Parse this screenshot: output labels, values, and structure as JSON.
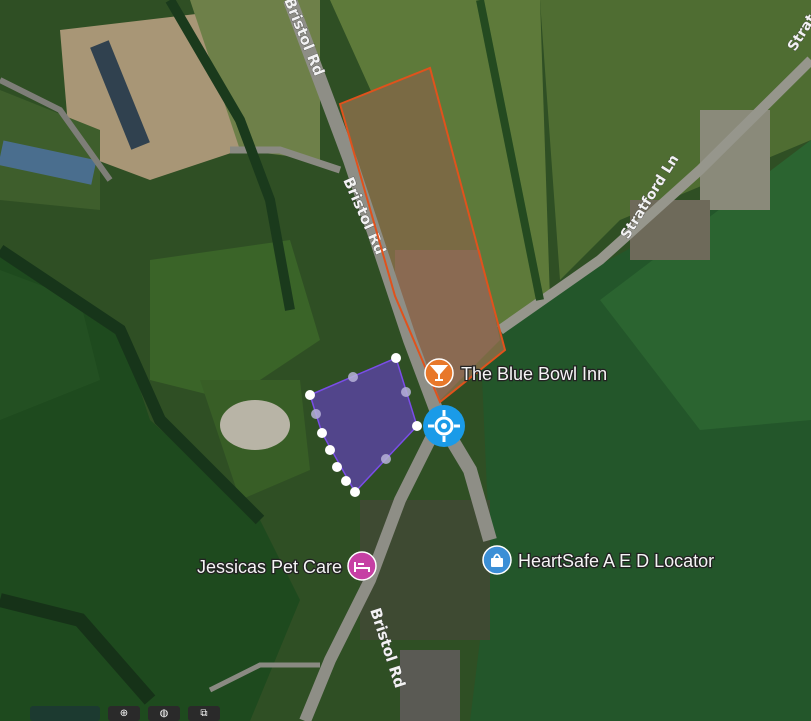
{
  "map": {
    "roads": {
      "bristol_rd_top": "Bristol Rd",
      "bristol_rd_mid": "Bristol Rd",
      "bristol_rd_bottom": "Bristol Rd",
      "stratford_ln": "Stratford Ln",
      "stratford_partial": "Strat"
    },
    "pois": [
      {
        "name": "The Blue Bowl Inn",
        "icon": "cocktail-glass-icon",
        "color": "#e8782a"
      },
      {
        "name": "Jessicas Pet Care",
        "icon": "pet-bed-icon",
        "color": "#c640a4"
      },
      {
        "name": "HeartSafe A E D Locator",
        "icon": "shopping-bag-icon",
        "color": "#3b8fd6"
      }
    ],
    "colors": {
      "orange_outline": "#e0521c",
      "purple_polygon": "#6b3fd0",
      "location_marker": "#1a9be8"
    }
  },
  "toolbar": {
    "items": [
      "pin-tool-icon",
      "globe-icon",
      "crop-icon"
    ]
  }
}
